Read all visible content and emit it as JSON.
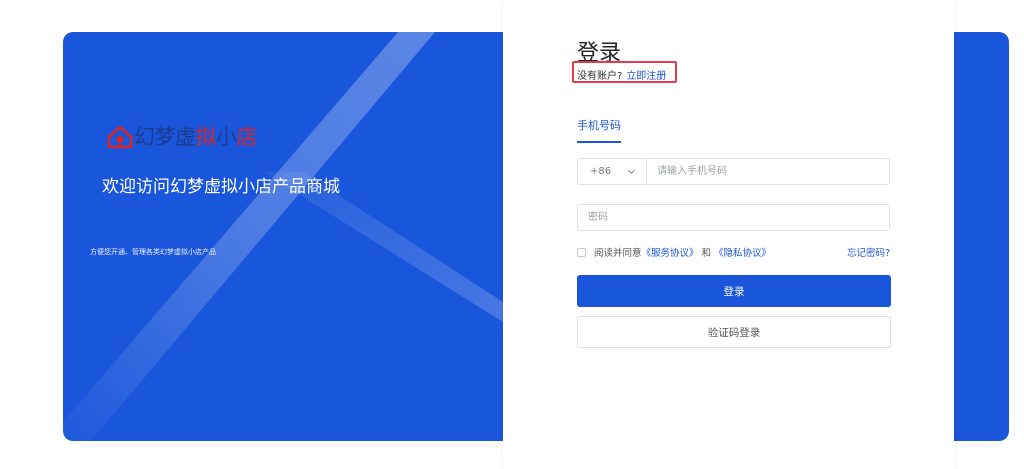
{
  "brand": {
    "name_part1": "幻梦虚",
    "name_part2": "拟",
    "name_part3": "小",
    "name_part4": "店",
    "welcome": "欢迎访问幻梦虚拟小店产品商城",
    "tagline": "方便您开通、管理各类幻梦虚拟小店产品"
  },
  "login": {
    "title": "登录",
    "no_account": "没有账户?",
    "register_link": "立即注册",
    "tab_phone": "手机号码",
    "country_code": "+86",
    "phone_placeholder": "请输入手机号码",
    "password_placeholder": "密码",
    "agree_prefix": "阅读并同意",
    "service_agreement": "《服务协议》",
    "and": "和",
    "privacy_agreement": "《隐私协议》",
    "forgot_password": "忘记密码?",
    "login_button": "登录",
    "sms_login_button": "验证码登录"
  },
  "colors": {
    "primary": "#1a56db",
    "banner": "#1a56db",
    "brand_dark": "#1e3a8a",
    "brand_red": "#d62626",
    "highlight": "#e5394f"
  },
  "icons": {
    "brand_logo": "house-logo-icon",
    "country_dropdown": "chevron-down-icon"
  }
}
